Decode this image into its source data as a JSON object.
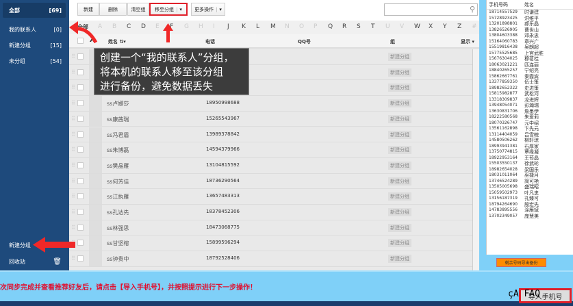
{
  "sidebar": {
    "items": [
      {
        "label": "全部",
        "count": "[69]"
      },
      {
        "label": "我的联系人",
        "count": "[0]"
      },
      {
        "label": "新建分组",
        "count": "[15]"
      },
      {
        "label": "未分组",
        "count": "[54]"
      }
    ],
    "new_group": "新建分组",
    "recycle": "回收站"
  },
  "toolbar": {
    "new": "新建",
    "delete": "删除",
    "clear_group": "清空组",
    "move_to_group": "移至分组",
    "more": "更多操作"
  },
  "alphabet": {
    "all": "全部",
    "letters": [
      "A",
      "B",
      "C",
      "D",
      "E",
      "F",
      "G",
      "H",
      "I",
      "J",
      "K",
      "L",
      "M",
      "N",
      "O",
      "P",
      "Q",
      "R",
      "S",
      "T",
      "U",
      "V",
      "W",
      "X",
      "Y",
      "Z",
      "#"
    ]
  },
  "table": {
    "headers": {
      "name": "姓名",
      "phone": "电话",
      "qq": "QQ号",
      "group": "组",
      "display": "显示"
    },
    "rows": [
      {
        "name": "",
        "phone": "",
        "group": "新建分组"
      },
      {
        "name": "",
        "phone": "",
        "group": "新建分组"
      },
      {
        "name": "",
        "phone": "",
        "group": "新建分组"
      },
      {
        "name": "ss卢娜莎",
        "phone": "18950998688",
        "group": "新建分组"
      },
      {
        "name": "ss康茜瑞",
        "phone": "15265543967",
        "group": "新建分组"
      },
      {
        "name": "ss冯君眉",
        "phone": "13989378842",
        "group": "新建分组"
      },
      {
        "name": "ss朱博磊",
        "phone": "14594379966",
        "group": "新建分组"
      },
      {
        "name": "ss樊晶雁",
        "phone": "13104815592",
        "group": "新建分组"
      },
      {
        "name": "ss何芳佳",
        "phone": "18736290564",
        "group": "新建分组"
      },
      {
        "name": "ss江执雁",
        "phone": "13657483313",
        "group": "新建分组"
      },
      {
        "name": "ss孔达先",
        "phone": "18378452306",
        "group": "新建分组"
      },
      {
        "name": "ss林强思",
        "phone": "18473068775",
        "group": "新建分组"
      },
      {
        "name": "ss甘坚榕",
        "phone": "15899596294",
        "group": "新建分组"
      },
      {
        "name": "ss钟贵中",
        "phone": "18792528406",
        "group": "新建分组"
      }
    ]
  },
  "tooltip": {
    "lines": [
      "创建一个“我的联系人”分组，",
      "将本机的联系人移至该分组",
      "进行备份，避免数据丢失"
    ]
  },
  "phone_list": {
    "headers": {
      "phone": "手机号码",
      "name": "姓名"
    },
    "rows": [
      [
        "18714557529",
        "时谦建"
      ],
      [
        "15728923425",
        "洪维平"
      ],
      [
        "13201898801",
        "郝乐晶"
      ],
      [
        "13826526905",
        "曹世山"
      ],
      [
        "13804603388",
        "邓永忠"
      ],
      [
        "15164060783",
        "章兴广"
      ],
      [
        "15519816438",
        "吴朗超"
      ],
      [
        "15775525685",
        "上官武胜"
      ],
      [
        "15676304025",
        "穆茗桂"
      ],
      [
        "18063021221",
        "匹连丽"
      ],
      [
        "18840265257",
        "宁绍亮"
      ],
      [
        "15862667761",
        "秦霞宾"
      ],
      [
        "13377859350",
        "伍士策"
      ],
      [
        "18982652322",
        "史进策"
      ],
      [
        "15815982877",
        "武松河"
      ],
      [
        "13318309837",
        "龙进辉"
      ],
      [
        "13948054071",
        "彭瀚瑞"
      ],
      [
        "13630831706",
        "詹墨伊"
      ],
      [
        "18222580568",
        "朱爱莉"
      ],
      [
        "18070326747",
        "元中绍"
      ],
      [
        "13561162898",
        "卞先元"
      ],
      [
        "13114404059",
        "吕雪皖"
      ],
      [
        "14580506262",
        "柳轩琼"
      ],
      [
        "18993941381",
        "石厚家"
      ],
      [
        "13750774815",
        "覃缘凝"
      ],
      [
        "18922953164",
        "王苟晶"
      ],
      [
        "15503550137",
        "徐武轮"
      ],
      [
        "18982654028",
        "梁国乐"
      ],
      [
        "18031011064",
        "巫捷月"
      ],
      [
        "13746524289",
        "简可艳"
      ],
      [
        "13505005698",
        "盛瑞昭"
      ],
      [
        "15059502973",
        "叶凡忠"
      ],
      [
        "13156187319",
        "孔臻可"
      ],
      [
        "18794264690",
        "殷宏先"
      ],
      [
        "14783895556",
        "涂雁斌"
      ],
      [
        "13702349057",
        "庞慧美"
      ]
    ]
  },
  "export_button": "剩余号码导出备份",
  "notice": "次同步完成并查看推荐好友后，请点击【导入手机号】，并按照提示进行下一步操作！",
  "faq_text": "çA FAQ",
  "import_button": "导入手机号",
  "colors": {
    "sidebar": "#1e4a7c",
    "accent_red": "#e0202a",
    "bottom_bar": "#7fd0f8",
    "export": "#ff8c00"
  }
}
